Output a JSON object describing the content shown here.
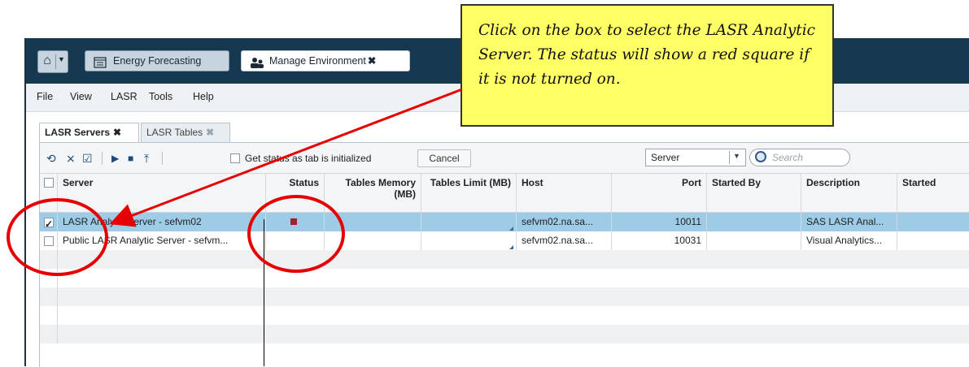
{
  "app": {
    "tabs": [
      {
        "label": "Energy Forecasting"
      },
      {
        "label": "Manage Environment",
        "close": "✖"
      }
    ]
  },
  "menu": [
    "File",
    "View",
    "LASR",
    "Tools",
    "Help"
  ],
  "panel_tabs": [
    {
      "label": "LASR Servers",
      "close": "✖"
    },
    {
      "label": "LASR Tables",
      "close": "✖"
    }
  ],
  "toolbar": {
    "status_label": "Get status as tab is initialized",
    "cancel_label": "Cancel",
    "select_value": "Server",
    "search_placeholder": "Search"
  },
  "grid": {
    "columns": [
      "Server",
      "Status",
      "Tables Memory (MB)",
      "Tables Limit (MB)",
      "Host",
      "Port",
      "Started By",
      "Description",
      "Started"
    ],
    "rows": [
      {
        "server": "LASR Analytic Server - sefvm02",
        "status": "stopped",
        "host": "sefvm02.na.sa...",
        "port": "10011",
        "description": "SAS LASR Anal...",
        "selected": true
      },
      {
        "server": "Public LASR Analytic Server - sefvm...",
        "status": "",
        "host": "sefvm02.na.sa...",
        "port": "10031",
        "description": "Visual Analytics...",
        "selected": false
      }
    ]
  },
  "callout": {
    "text": "Click on the box to select the LASR Analytic Server.  The status will show a red square if it is not turned on."
  },
  "colors": {
    "status_stopped": "#a51c2a",
    "selection": "#9ecbe6",
    "annotation_ring": "#e60000",
    "callout_bg": "#ffff66"
  }
}
